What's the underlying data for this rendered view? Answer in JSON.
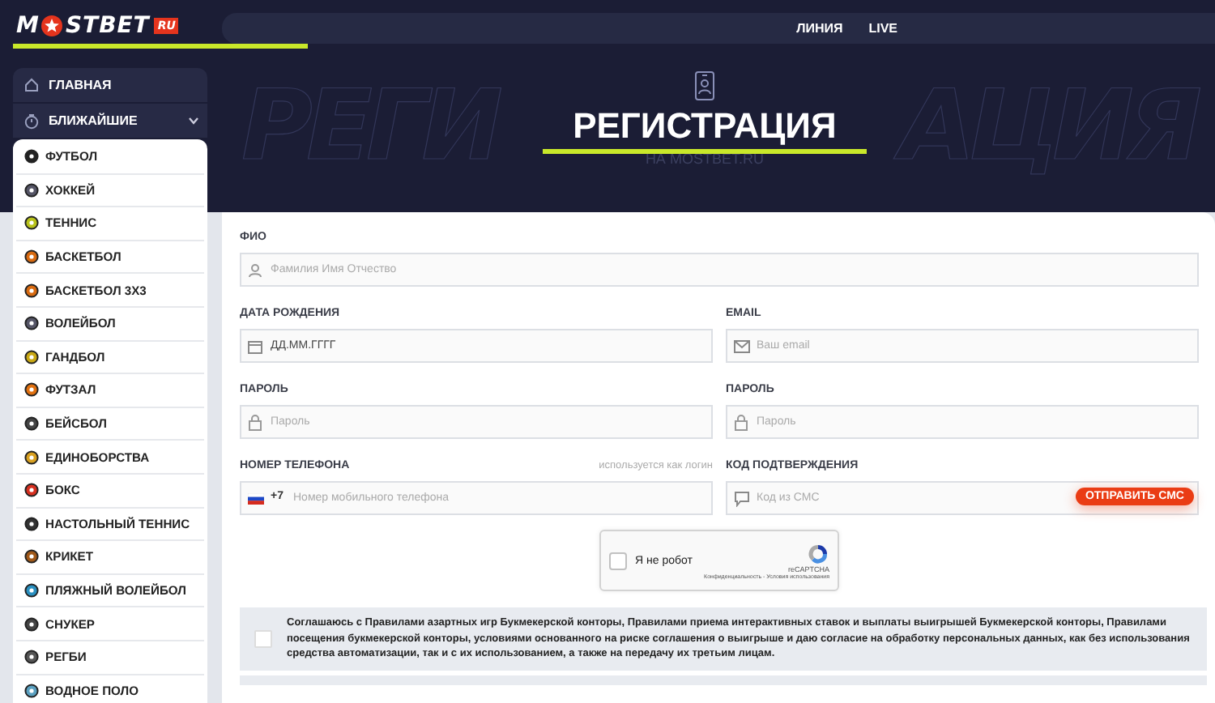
{
  "header": {
    "logo": {
      "before": "M",
      "after": "STBET",
      "badge": "RU"
    },
    "nav": [
      {
        "label": "ЛИНИЯ",
        "selected": false
      },
      {
        "label": "LIVE",
        "selected": false
      }
    ]
  },
  "sidebar": {
    "top": [
      {
        "kind": "home",
        "label": "ГЛАВНАЯ"
      },
      {
        "kind": "timer",
        "label": "БЛИЖАЙШИЕ",
        "expanded": false
      }
    ],
    "sports": [
      {
        "label": "ФУТБОЛ"
      },
      {
        "label": "ХОККЕЙ"
      },
      {
        "label": "ТЕННИС"
      },
      {
        "label": "БАСКЕТБОЛ"
      },
      {
        "label": "БАСКЕТБОЛ 3Х3"
      },
      {
        "label": "ВОЛЕЙБОЛ"
      },
      {
        "label": "ГАНДБОЛ"
      },
      {
        "label": "ФУТЗАЛ"
      },
      {
        "label": "БЕЙСБОЛ"
      },
      {
        "label": "ЕДИНОБОРСТВА"
      },
      {
        "label": "БОКС"
      },
      {
        "label": "НАСТОЛЬНЫЙ ТЕННИС"
      },
      {
        "label": "КРИКЕТ"
      },
      {
        "label": "ПЛЯЖНЫЙ ВОЛЕЙБОЛ"
      },
      {
        "label": "СНУКЕР"
      },
      {
        "label": "РЕГБИ"
      },
      {
        "label": "ВОДНОЕ ПОЛО"
      }
    ]
  },
  "hero": {
    "background_text": [
      "РЕГИ",
      "АЦИЯ"
    ],
    "title": "РЕГИСТРАЦИЯ",
    "subtitle": "НА MOSTBET.RU"
  },
  "form": {
    "rows": [
      [
        {
          "label": "ФИО",
          "kind": "person",
          "placeholder": "Фамилия Имя Отчество"
        }
      ],
      [
        {
          "label": "ДАТА РОЖДЕНИЯ",
          "kind": "calendar",
          "placeholder": "ДД.ММ.ГГГГ"
        },
        {
          "label": "EMAIL",
          "kind": "mail",
          "placeholder": "Ваш email"
        }
      ],
      [
        {
          "label": "ПАРОЛЬ",
          "kind": "lock",
          "placeholder": "Пароль"
        },
        {
          "label": "ПАРОЛЬ",
          "kind": "lock",
          "placeholder": "Пароль"
        }
      ],
      [
        {
          "label": "НОМЕР ТЕЛЕФОНА",
          "hint": "используется как логин",
          "kind": "phone",
          "prefix": "+7",
          "placeholder": "Номер мобильного телефона"
        },
        {
          "label": "КОД ПОДТВЕРЖДЕНИЯ",
          "kind": "sms",
          "placeholder": "Код из СМС",
          "button": "ОТПРАВИТЬ СМС"
        }
      ]
    ],
    "captcha": {
      "label": "Я не робот",
      "checked": false,
      "brand": "reCAPTCHA",
      "links": "Конфиденциальность - Условия использования"
    },
    "consent": {
      "checked": false,
      "text": "Соглашаюсь с Правилами азартных игр Букмекерской конторы, Правилами приема интерактивных ставок и выплаты выигрышей Букмекерской конторы, Правилами посещения букмекерской конторы, условиями основанного на риске соглашения о выигрыше и даю согласие на обработку персональных данных, как без использования средства автоматизации, так и с их использованием, а также на передачу их третьим лицам."
    }
  }
}
